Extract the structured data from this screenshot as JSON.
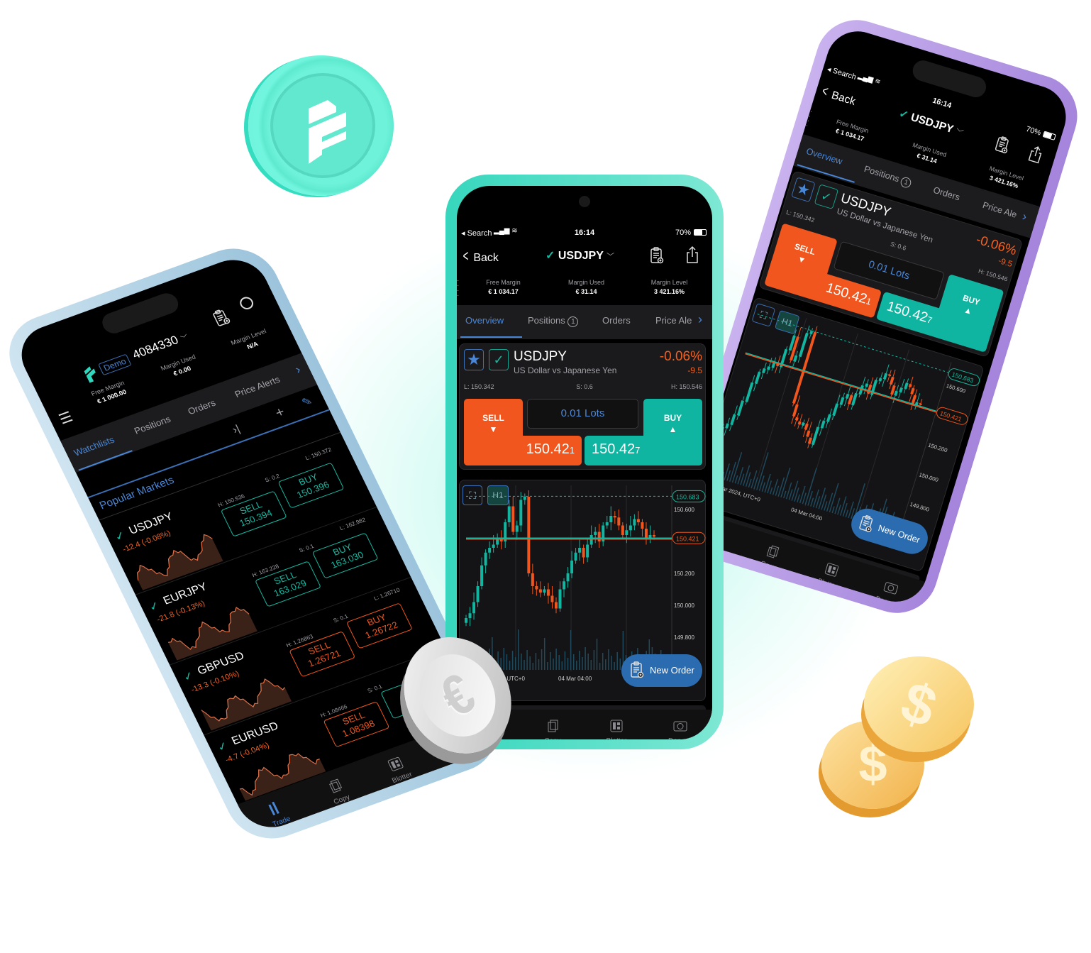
{
  "colors": {
    "sell": "#f0561d",
    "buy": "#0fb5a0",
    "accent": "#4a86d6",
    "new_order": "#2b6cb0",
    "logo_coin": "#6ff3dc"
  },
  "status_bar": {
    "back_app": "◂ Search",
    "time": "16:14",
    "battery": "70%"
  },
  "trade": {
    "back_label": "Back",
    "symbol": "USDJPY",
    "account": [
      {
        "label": "Free Margin",
        "value": "€ 1 034.17"
      },
      {
        "label": "Margin Used",
        "value": "€ 31.14"
      },
      {
        "label": "Margin Level",
        "value": "3 421.16%"
      }
    ],
    "tabs": [
      {
        "label": "Overview",
        "active": true
      },
      {
        "label": "Positions",
        "badge": "1"
      },
      {
        "label": "Orders"
      },
      {
        "label": "Price Ale"
      }
    ],
    "instrument": {
      "name": "USDJPY",
      "description": "US Dollar vs Japanese Yen",
      "change_pct": "-0.06%",
      "change_pts": "-9.5",
      "low": "L: 150.342",
      "spread": "S: 0.6",
      "high": "H: 150.546"
    },
    "sell": {
      "label": "SELL",
      "price_main": "150.42",
      "price_pip": "1"
    },
    "buy": {
      "label": "BUY",
      "price_main": "150.42",
      "price_pip": "7"
    },
    "lots": "0.01 Lots",
    "timeframe": "H1",
    "new_order_label": "New Order"
  },
  "chart_data": {
    "type": "candlestick",
    "y_ticks": [
      "150.600",
      "150.200",
      "150.000",
      "149.800"
    ],
    "y_ticks_values": [
      150.6,
      150.2,
      150.0,
      149.8
    ],
    "x_labels": [
      "01 Mar 2024, UTC+0",
      "04 Mar 04:00"
    ],
    "current_price_label": "150.421",
    "current_price": 150.421,
    "high_line_label": "150.683",
    "high_line": 150.683,
    "closes": [
      149.92,
      149.95,
      150.02,
      150.12,
      150.25,
      150.33,
      150.36,
      150.38,
      150.42,
      150.4,
      150.52,
      150.62,
      150.46,
      150.5,
      150.66,
      150.68,
      150.2,
      150.12,
      150.1,
      150.08,
      150.1,
      150.06,
      150.02,
      149.98,
      150.1,
      150.15,
      150.2,
      150.28,
      150.33,
      150.36,
      150.3,
      150.38,
      150.44,
      150.46,
      150.4,
      150.5,
      150.52,
      150.56,
      150.55,
      150.5,
      150.44,
      150.47,
      150.5,
      150.54,
      150.52,
      150.48,
      150.42,
      150.44,
      150.43
    ]
  },
  "bottom_nav": [
    {
      "label": "Trade",
      "icon": "candles-icon",
      "active": true
    },
    {
      "label": "Copy",
      "icon": "copy-icon"
    },
    {
      "label": "Blotter",
      "icon": "blotter-icon"
    },
    {
      "label": "Deposit",
      "icon": "deposit-icon"
    }
  ],
  "watchlist": {
    "demo_badge": "Demo",
    "account_number": "4084330",
    "account": [
      {
        "label": "Free Margin",
        "value": "€ 1 000.00"
      },
      {
        "label": "Margin Used",
        "value": "€ 0.00"
      },
      {
        "label": "Margin Level",
        "value": "N/A"
      }
    ],
    "tabs": [
      {
        "label": "Watchlists",
        "active": true
      },
      {
        "label": "Positions"
      },
      {
        "label": "Orders"
      },
      {
        "label": "Price Alerts"
      }
    ],
    "section_title": "Popular Markets",
    "rows": [
      {
        "symbol": "USDJPY",
        "change": "-12.4 (-0.08%)",
        "high": "H: 150.536",
        "spread": "S: 0.2",
        "low": "L: 150.372",
        "sell": "150.394",
        "buy": "150.396",
        "sell_color": "teal",
        "buy_color": "teal"
      },
      {
        "symbol": "EURJPY",
        "change": "-21.8 (-0.13%)",
        "high": "H: 163.228",
        "spread": "S: 0.1",
        "low": "L: 162.982",
        "sell": "163.029",
        "buy": "163.030",
        "sell_color": "teal",
        "buy_color": "teal"
      },
      {
        "symbol": "GBPUSD",
        "change": "-13.3 (-0.10%)",
        "high": "H: 1.26863",
        "spread": "S: 0.1",
        "low": "L: 1.26710",
        "sell": "1.26721",
        "buy": "1.26722",
        "sell_color": "orange",
        "buy_color": "orange"
      },
      {
        "symbol": "EURUSD",
        "change": "-4.7 (-0.04%)",
        "high": "H: 1.08466",
        "spread": "S: 0.1",
        "low": "L: 1.08",
        "sell": "1.08398",
        "buy": "1.08",
        "sell_color": "orange",
        "buy_color": "teal"
      }
    ],
    "sell_label": "SELL",
    "buy_label": "BUY"
  }
}
